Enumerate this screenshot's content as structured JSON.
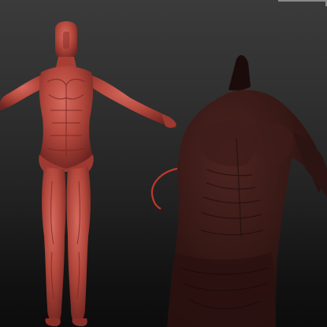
{
  "viewport": {
    "background_top": "#3b3b3b",
    "background_bottom": "#0c0c0c"
  },
  "model": {
    "front_figure": "anatomy-muscle-figure",
    "front_color": "#b3473c",
    "front_highlight": "#d9736a",
    "front_shadow": "#6e2420",
    "closeup_figure": "anatomy-muscle-closeup",
    "closeup_color": "#3a1a17",
    "closeup_highlight": "#5a2a25"
  },
  "brush_cursor_color": "#c0392b",
  "corner_marker_color": "#8a8a8a"
}
